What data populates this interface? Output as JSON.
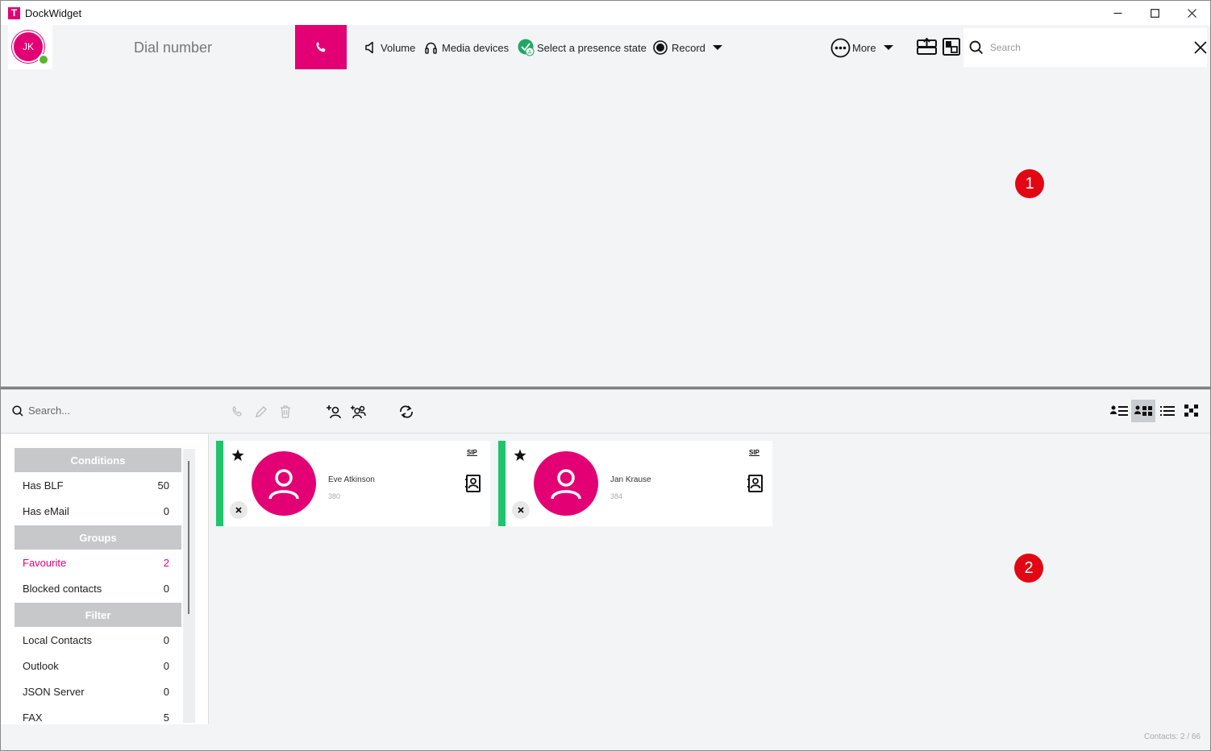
{
  "window": {
    "title": "DockWidget",
    "logo_letter": "T"
  },
  "user": {
    "initials": "JK"
  },
  "toolbar": {
    "dial_placeholder": "Dial number",
    "volume_label": "Volume",
    "media_devices_label": "Media devices",
    "presence_label": "Select a presence state",
    "record_label": "Record",
    "more_label": "More",
    "search_placeholder": "Search"
  },
  "markers": {
    "m1": "1",
    "m2": "2"
  },
  "contacts_toolbar": {
    "search_placeholder": "Search..."
  },
  "sidebar": {
    "conditions_header": "Conditions",
    "conditions": [
      {
        "label": "Has BLF",
        "count": "50"
      },
      {
        "label": "Has eMail",
        "count": "0"
      }
    ],
    "groups_header": "Groups",
    "groups": [
      {
        "label": "Favourite",
        "count": "2"
      },
      {
        "label": "Blocked contacts",
        "count": "0"
      }
    ],
    "filter_header": "Filter",
    "filters": [
      {
        "label": "Local Contacts",
        "count": "0"
      },
      {
        "label": "Outlook",
        "count": "0"
      },
      {
        "label": "JSON Server",
        "count": "0"
      },
      {
        "label": "FAX",
        "count": "5"
      }
    ]
  },
  "contacts": [
    {
      "name": "Eve Atkinson",
      "number": "380",
      "sip": "SIP"
    },
    {
      "name": "Jan Krause",
      "number": "384",
      "sip": "SIP"
    }
  ],
  "status_bar": {
    "contacts_count": "Contacts: 2 / 66"
  },
  "colors": {
    "brand": "#e20074",
    "presence_available": "#5cb531",
    "contact_status": "#1fc46b",
    "marker": "#e30613"
  },
  "icons": [
    "phone-icon",
    "speaker-icon",
    "headset-icon",
    "presence-icon",
    "record-icon",
    "more-icon",
    "chevron-down-icon",
    "search-icon",
    "close-icon",
    "star-icon",
    "person-icon",
    "address-book-icon"
  ]
}
